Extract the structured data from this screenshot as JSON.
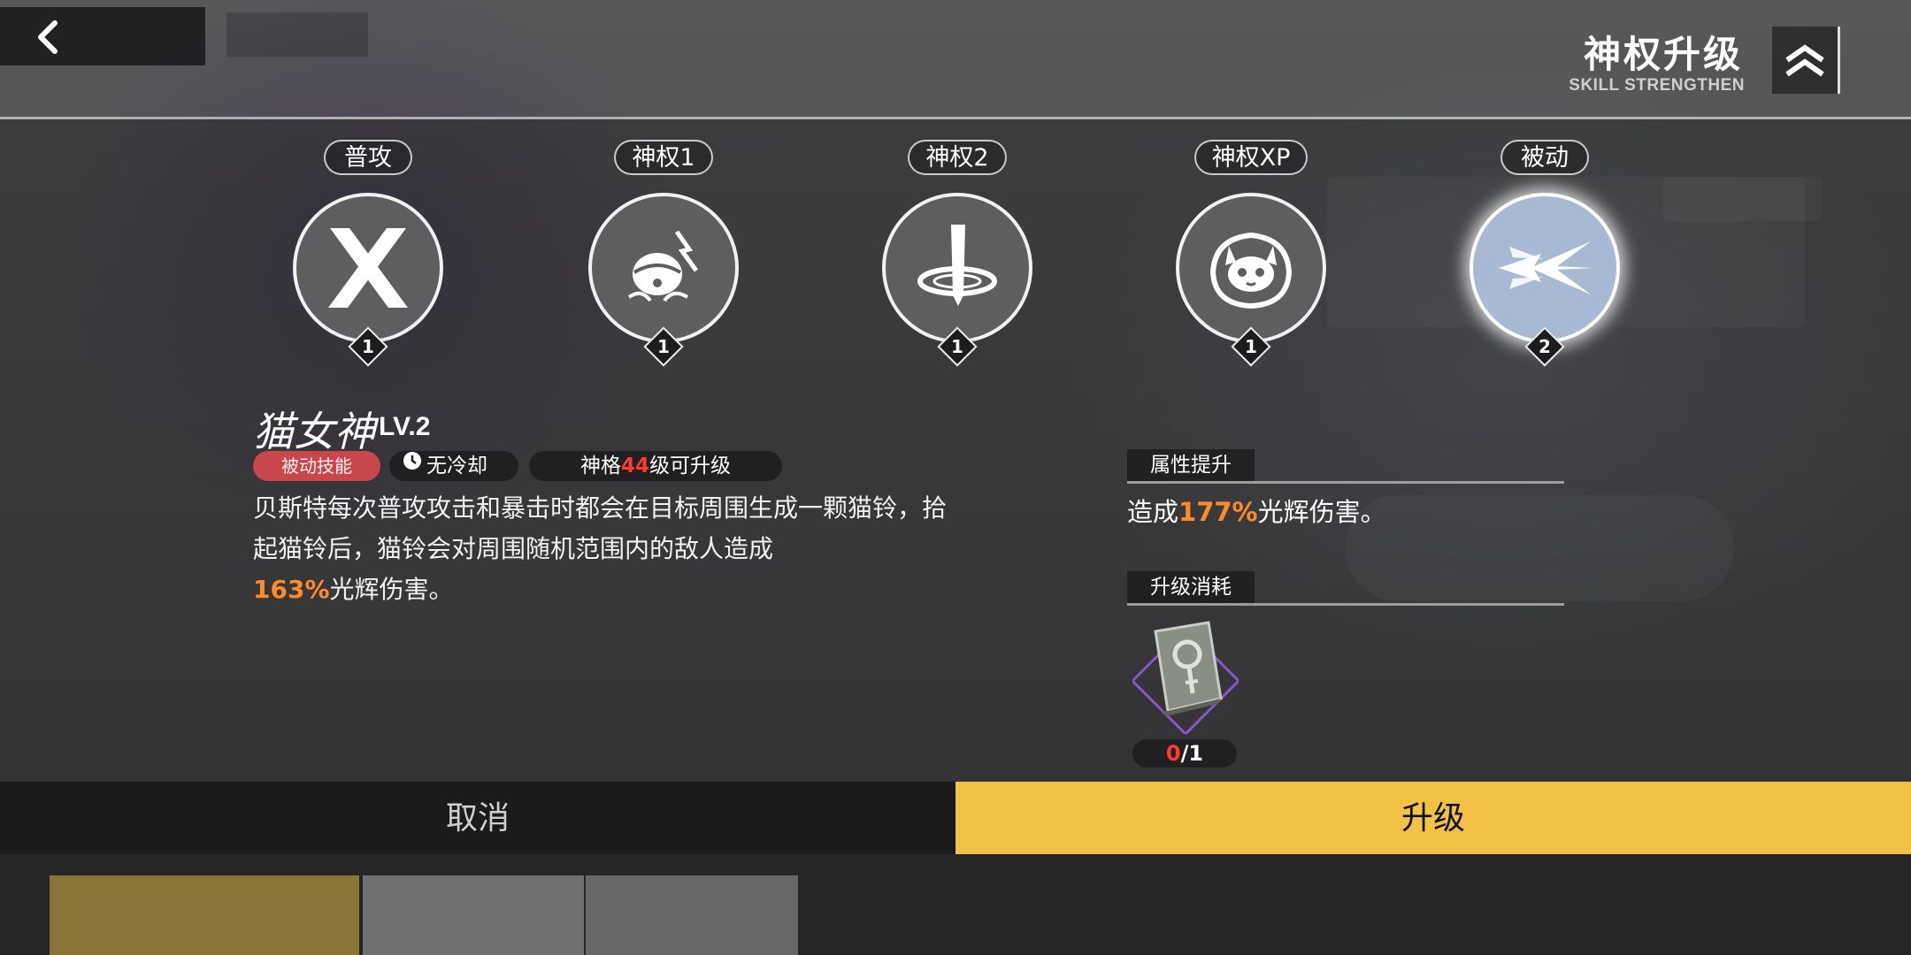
{
  "header": {
    "title": "神权升级",
    "subtitle": "SKILL STRENGTHEN"
  },
  "skills": [
    {
      "label": "普攻",
      "level": "1",
      "icon": "crossed-blades-icon"
    },
    {
      "label": "神权1",
      "level": "1",
      "icon": "cat-bell-lightning-icon"
    },
    {
      "label": "神权2",
      "level": "1",
      "icon": "sword-vortex-icon"
    },
    {
      "label": "神权XP",
      "level": "1",
      "icon": "cat-face-swirl-icon"
    },
    {
      "label": "被动",
      "level": "2",
      "icon": "radiant-burst-icon",
      "selected": true
    }
  ],
  "detail": {
    "name": "猫女神",
    "level_text": "LV.2",
    "tag_passive": "被动技能",
    "tag_cooldown": "无冷却",
    "upgrade_req_prefix": "神格",
    "upgrade_req_level": "44",
    "upgrade_req_suffix": "级可升级",
    "desc_main": "贝斯特每次普攻攻击和暴击时都会在目标周围生成一颗猫铃，拾起猫铃后，猫铃会对周围随机范围内的敌人造成",
    "desc_value": "163%",
    "desc_tail": "光辉伤害。"
  },
  "attribute": {
    "header": "属性提升",
    "prefix": "造成",
    "value": "177%",
    "suffix": "光辉伤害。"
  },
  "cost": {
    "header": "升级消耗",
    "item_icon": "skill-book-icon",
    "have": "0",
    "need": "/1"
  },
  "buttons": {
    "cancel": "取消",
    "upgrade": "升级"
  },
  "colors": {
    "accent_yellow": "#f1c245",
    "highlight_orange": "#ff8a2a",
    "requirement_red": "#ff3b30",
    "passive_tag": "#c8474c"
  }
}
